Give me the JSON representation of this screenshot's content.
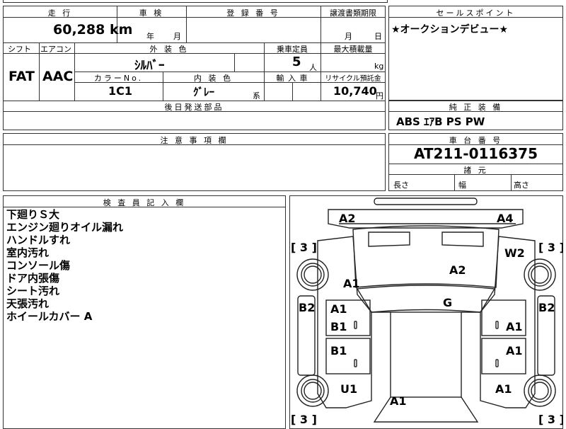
{
  "top_strip": "",
  "mileage": {
    "label": "走 行",
    "value": "60,288",
    "unit": "km"
  },
  "inspection": {
    "label": "車 検",
    "year": "年",
    "month": "月"
  },
  "registration": {
    "label": "登 録 番 号",
    "value": ""
  },
  "transfer": {
    "label": "譲渡書類期限",
    "month": "月",
    "day": "日"
  },
  "sales_point": {
    "label": "セールスポイント",
    "text": "★オークションデビュー★"
  },
  "shift": {
    "label": "シフト",
    "value": "FAT"
  },
  "aircon": {
    "label": "エアコン",
    "value": "AAC"
  },
  "exterior_color": {
    "label": "外 装 色",
    "value": "ｼﾙﾊﾞｰ"
  },
  "capacity": {
    "label": "乗車定員",
    "value": "5",
    "unit": "人"
  },
  "max_load": {
    "label": "最大積載量",
    "unit": "kg"
  },
  "color_no": {
    "label": "カラーNo.",
    "value": "1C1"
  },
  "interior_color": {
    "label": "内 装 色",
    "value": "ｸﾞﾚｰ",
    "suffix": "系"
  },
  "import": {
    "label": "輸 入 車"
  },
  "recycle": {
    "label": "リサイクル預託金",
    "value": "10,740",
    "unit": "円"
  },
  "later_parts": {
    "label": "後日発送部品"
  },
  "equipment": {
    "label": "純 正 装 備",
    "value": "ABS ｴｱB PS PW"
  },
  "notes": {
    "label": "注 意 事 項 欄"
  },
  "chassis": {
    "label": "車 台 番 号",
    "value": "AT211-0116375"
  },
  "dimensions": {
    "label": "諸 元",
    "length": "長さ",
    "width": "幅",
    "height": "高さ"
  },
  "inspector": {
    "label": "検 査 員 記 入 欄",
    "lines": [
      "下廻りＳ大",
      "エンジン廻りオイル漏れ",
      "ハンドルすれ",
      "室内汚れ",
      "コンソール傷",
      "ドア内張傷",
      "シート汚れ",
      "天張汚れ",
      "ホイールカバー A"
    ]
  },
  "diagram": {
    "tire_left_top": "[ 3 ]",
    "tire_right_top": "[ 3 ]",
    "tire_left_bottom": "[ 3 ]",
    "tire_right_bottom": "[ 3 ]",
    "m_a2_front_left": "A2",
    "m_a4_front_right": "A4",
    "m_w2": "W2",
    "m_a2_bonnet": "A2",
    "m_a1_left_fender": "A1",
    "m_g": "G",
    "m_b2_left": "B2",
    "m_b2_right": "B2",
    "m_a1_left_front_door": "A1",
    "m_b1_left_front_door": "B1",
    "m_a1_right_front_door": "A1",
    "m_b1_left_rear_door": "B1",
    "m_a1_right_rear_door": "A1",
    "m_u1": "U1",
    "m_a1_right_rear": "A1",
    "m_a1_rear": "A1"
  }
}
